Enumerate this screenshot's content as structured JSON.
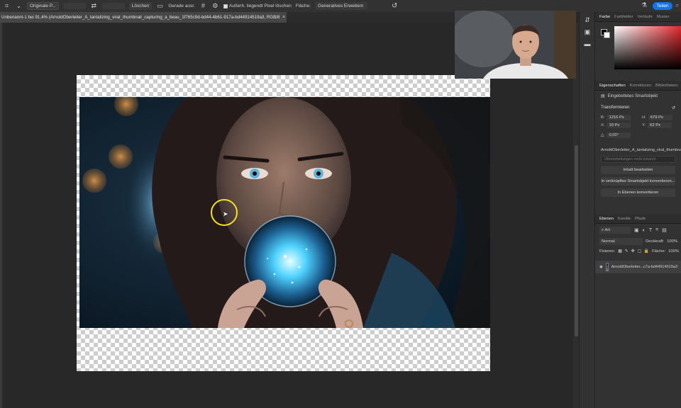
{
  "options_bar": {
    "move_icon": "move-tool-icon",
    "ratio_dropdown": "Originale P...",
    "swap_icon": "swap-icon",
    "clear_button": "Löschen",
    "straighten_label": "Gerade ausr.",
    "grid_icon": "grid-overlay-icon",
    "settings_icon": "gear-icon",
    "delete_pixels_label": "Außerh. liegendt Pixel löschen",
    "fill_label": "Fläche:",
    "fill_select": "Generatives Erweitern",
    "undo_icon": "undo-icon",
    "flask_icon": "flask-icon",
    "share_button": "Teilen"
  },
  "document_tab": {
    "title": "Unbenannt-1 bei 91,4% (ArnoldOberleiter_A_tantalizing_viral_thumbnail_capturing_a_beau_1f765c9d-bd44-4b61-917a-bd44914519a3, RGB/8) *",
    "close": "×"
  },
  "panel_icons": [
    "arrows-icon",
    "tool-presets-icon",
    "comment-icon"
  ],
  "color_panel": {
    "tabs": [
      "Farbe",
      "Farbfelder",
      "Verläufe",
      "Muster"
    ],
    "active_tab": 0,
    "hue_color": "#e3262b"
  },
  "properties_panel": {
    "tabs": [
      "Eigenschaften",
      "Korrekturen",
      "Bibliotheken"
    ],
    "type_label": "Eingebettetes Smartobjekt",
    "transform_title": "Transformieren",
    "w_label": "B:",
    "w_value": "1216 Px",
    "h_label": "H:",
    "h_value": "679 Px",
    "x_label": "X:",
    "x_value": "10 Px",
    "y_label": "Y:",
    "y_value": "62 Px",
    "angle_value": "0,00°",
    "file_name": "ArnoldOberleiter_A_tantalizing_viral_thumbnail_c",
    "file_placeholder": "Überarbeitungen nicht erkannt",
    "buttons": [
      "Inhalt bearbeiten",
      "In verknüpftes Smartobjekt konvertieren...",
      "In Ebenen konvertieren"
    ]
  },
  "layers_panel": {
    "tabs": [
      "Ebenen",
      "Kanäle",
      "Pfade"
    ],
    "kind_filter": "Art",
    "blend_mode": "Normal",
    "opacity_label": "Deckkraft:",
    "opacity_value": "100%",
    "lock_label": "Fixieren:",
    "fill_label": "Fläche:",
    "fill_value": "100%",
    "layer_name": "ArnoldOberleiter...c7a-bd44914519a3"
  }
}
